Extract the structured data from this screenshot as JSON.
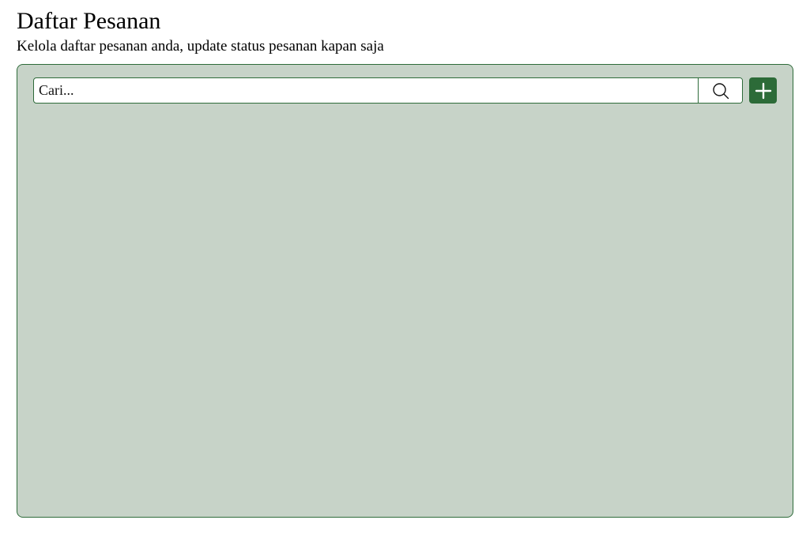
{
  "header": {
    "title": "Daftar Pesanan",
    "subtitle": "Kelola daftar pesanan anda, update status pesanan kapan saja"
  },
  "toolbar": {
    "search": {
      "placeholder": "Cari...",
      "value": "",
      "icon": "search-icon"
    },
    "add_button": {
      "icon": "plus-icon"
    }
  },
  "colors": {
    "accent": "#2c6b38",
    "panel_background": "#c7d3c8",
    "panel_border": "#2e6b3a"
  }
}
